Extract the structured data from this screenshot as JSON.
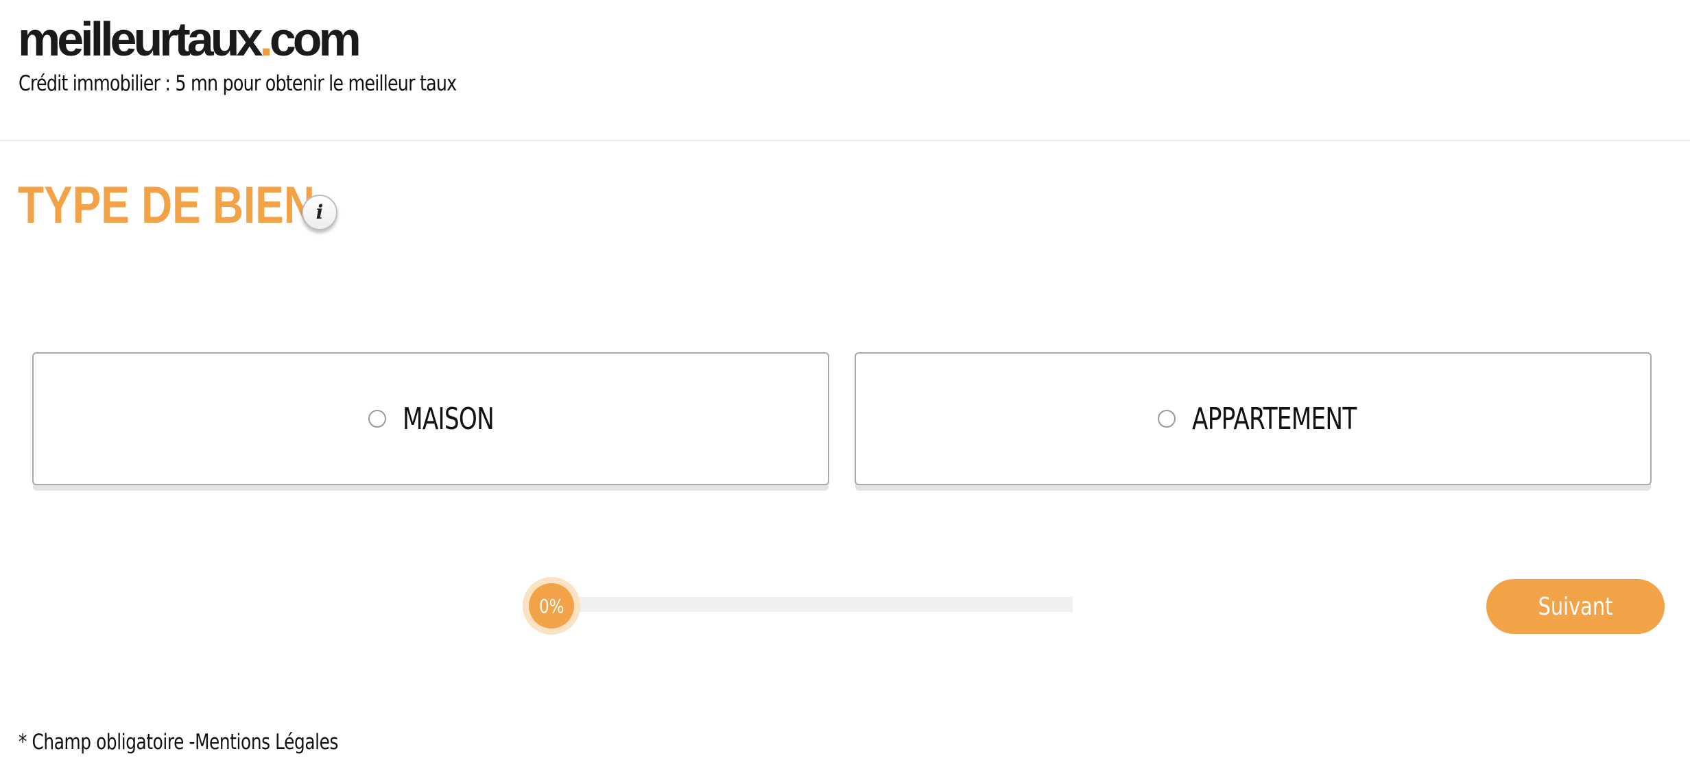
{
  "header": {
    "logo_main": "meilleurtaux",
    "logo_dot": ".",
    "logo_tld": "com",
    "tagline": "Crédit immobilier : 5 mn pour obtenir le meilleur taux"
  },
  "section": {
    "title": "TYPE DE BIEN",
    "info_icon": "info-icon",
    "info_glyph": "i"
  },
  "options": [
    {
      "label": "MAISON",
      "selected": false
    },
    {
      "label": "APPARTEMENT",
      "selected": false
    }
  ],
  "progress": {
    "value": 0,
    "label": "0%"
  },
  "navigation": {
    "next_label": "Suivant"
  },
  "footer": {
    "required_note": "* Champ obligatoire -",
    "legal_link": "Mentions Légales"
  },
  "colors": {
    "accent": "#f2a247",
    "text": "#111111",
    "border": "#a9a9a9",
    "track": "#efefef"
  }
}
